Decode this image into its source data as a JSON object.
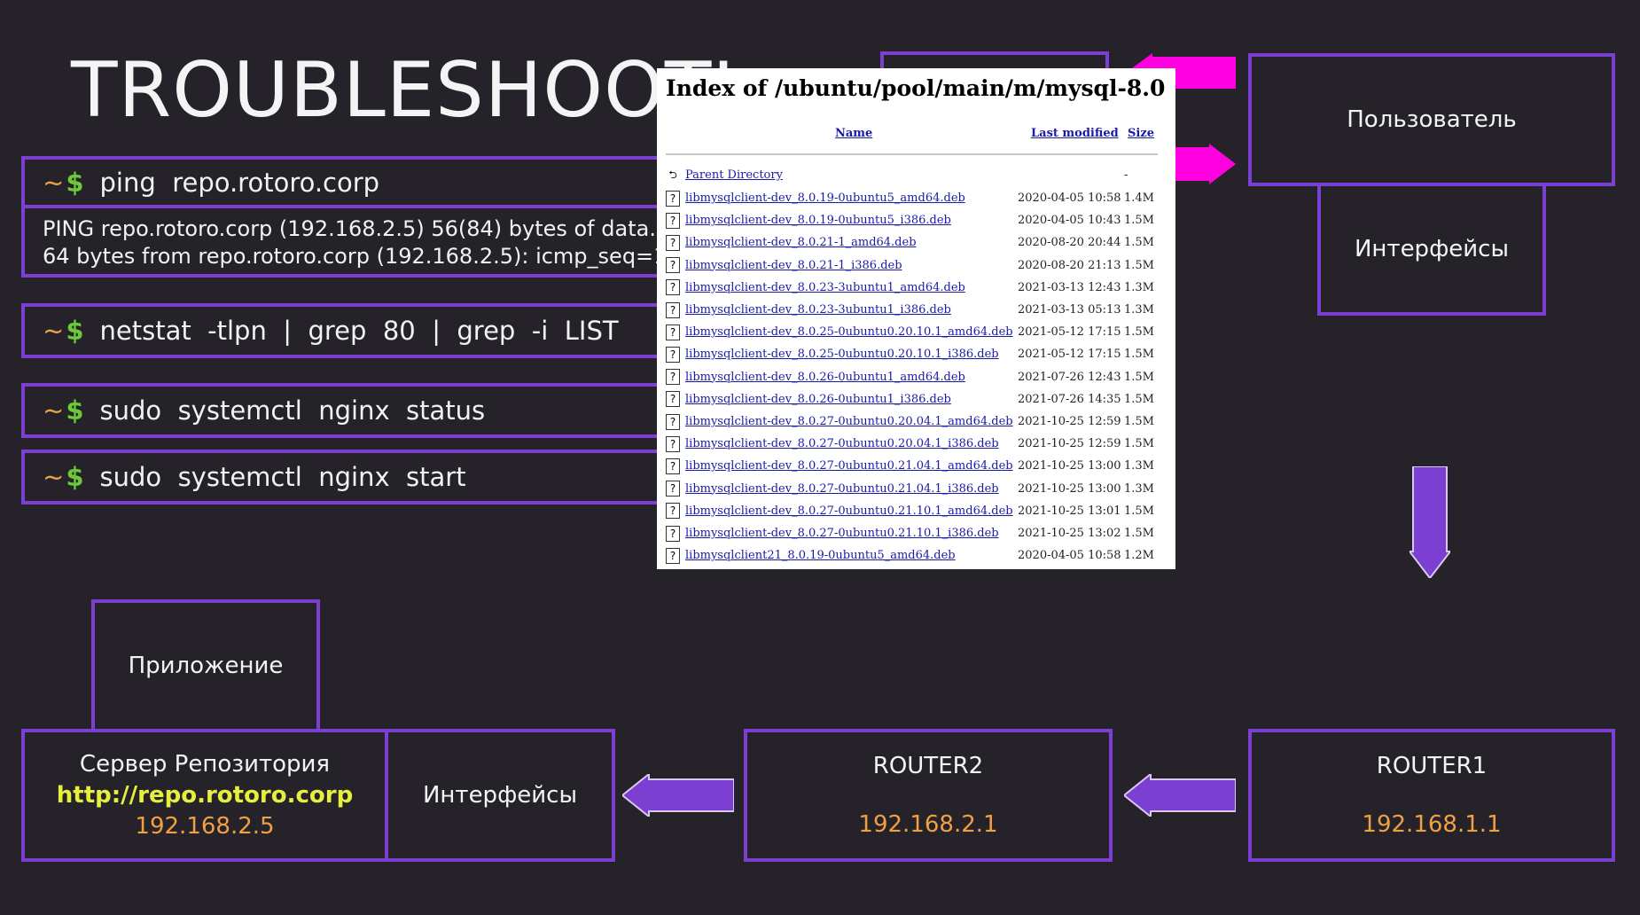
{
  "title": "TROUBLESHOOTI",
  "terminal": {
    "tilde": "~",
    "dollar": "$",
    "commands": [
      "ping  repo.rotoro.corp",
      "netstat  -tlpn  |  grep  80  |  grep  -i  LIST",
      "sudo  systemctl  nginx  status",
      "sudo  systemctl  nginx  start"
    ],
    "ping_output": [
      "PING repo.rotoro.corp (192.168.2.5) 56(84) bytes of data.",
      "64 bytes from repo.rotoro.corp (192.168.2.5): icmp_seq=1 ttl=6"
    ]
  },
  "index_page": {
    "heading": "Index of /ubuntu/pool/main/m/mysql-8.0",
    "col_name": "Name",
    "col_modified": "Last modified",
    "col_size": "Size",
    "parent": {
      "name": "Parent Directory",
      "size": "-"
    },
    "files": [
      {
        "name": "libmysqlclient-dev_8.0.19-0ubuntu5_amd64.deb",
        "date": "2020-04-05 10:58",
        "size": "1.4M"
      },
      {
        "name": "libmysqlclient-dev_8.0.19-0ubuntu5_i386.deb",
        "date": "2020-04-05 10:43",
        "size": "1.5M"
      },
      {
        "name": "libmysqlclient-dev_8.0.21-1_amd64.deb",
        "date": "2020-08-20 20:44",
        "size": "1.5M"
      },
      {
        "name": "libmysqlclient-dev_8.0.21-1_i386.deb",
        "date": "2020-08-20 21:13",
        "size": "1.5M"
      },
      {
        "name": "libmysqlclient-dev_8.0.23-3ubuntu1_amd64.deb",
        "date": "2021-03-13 12:43",
        "size": "1.3M"
      },
      {
        "name": "libmysqlclient-dev_8.0.23-3ubuntu1_i386.deb",
        "date": "2021-03-13 05:13",
        "size": "1.3M"
      },
      {
        "name": "libmysqlclient-dev_8.0.25-0ubuntu0.20.10.1_amd64.deb",
        "date": "2021-05-12 17:15",
        "size": "1.5M"
      },
      {
        "name": "libmysqlclient-dev_8.0.25-0ubuntu0.20.10.1_i386.deb",
        "date": "2021-05-12 17:15",
        "size": "1.5M"
      },
      {
        "name": "libmysqlclient-dev_8.0.26-0ubuntu1_amd64.deb",
        "date": "2021-07-26 12:43",
        "size": "1.5M"
      },
      {
        "name": "libmysqlclient-dev_8.0.26-0ubuntu1_i386.deb",
        "date": "2021-07-26 14:35",
        "size": "1.5M"
      },
      {
        "name": "libmysqlclient-dev_8.0.27-0ubuntu0.20.04.1_amd64.deb",
        "date": "2021-10-25 12:59",
        "size": "1.5M"
      },
      {
        "name": "libmysqlclient-dev_8.0.27-0ubuntu0.20.04.1_i386.deb",
        "date": "2021-10-25 12:59",
        "size": "1.5M"
      },
      {
        "name": "libmysqlclient-dev_8.0.27-0ubuntu0.21.04.1_amd64.deb",
        "date": "2021-10-25 13:00",
        "size": "1.3M"
      },
      {
        "name": "libmysqlclient-dev_8.0.27-0ubuntu0.21.04.1_i386.deb",
        "date": "2021-10-25 13:00",
        "size": "1.3M"
      },
      {
        "name": "libmysqlclient-dev_8.0.27-0ubuntu0.21.10.1_amd64.deb",
        "date": "2021-10-25 13:01",
        "size": "1.5M"
      },
      {
        "name": "libmysqlclient-dev_8.0.27-0ubuntu0.21.10.1_i386.deb",
        "date": "2021-10-25 13:02",
        "size": "1.5M"
      },
      {
        "name": "libmysqlclient21_8.0.19-0ubuntu5_amd64.deb",
        "date": "2020-04-05 10:58",
        "size": "1.2M"
      }
    ]
  },
  "diagram": {
    "user": "Пользователь",
    "interfaces_top": "Интерфейсы",
    "application": "Приложение",
    "repo_server": {
      "label": "Сервер Репозитория",
      "url": "http://repo.rotoro.corp",
      "ip": "192.168.2.5"
    },
    "interfaces_bottom": "Интерфейсы",
    "router2": {
      "label": "ROUTER2",
      "ip": "192.168.2.1"
    },
    "router1": {
      "label": "ROUTER1",
      "ip": "192.168.1.1"
    }
  },
  "colors": {
    "background": "#25222a",
    "border": "#7b3fd1",
    "arrow_purple": "#7b3fd1",
    "arrow_magenta": "#ff00e0",
    "url_yellow": "#e6f03c",
    "ip_orange": "#f0a044"
  }
}
